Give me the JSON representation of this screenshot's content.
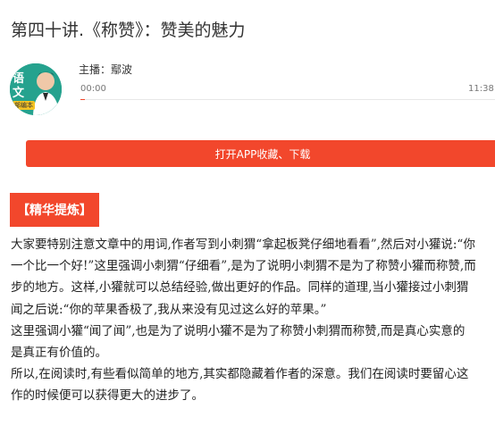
{
  "header": {
    "title": "第四十讲.《称赞》：赞美的魅力"
  },
  "player": {
    "cover_text": "语文",
    "cover_badge": "部编本",
    "host_label": "主播：鄢波",
    "current_time": "00:00",
    "duration": "11:38",
    "progress": 0.01
  },
  "app_button": {
    "label": "打开APP收藏、下载"
  },
  "section": {
    "tag": "【精华提炼】"
  },
  "article": {
    "lines": [
      "大家要特别注意文章中的用词,作者写到小刺猬“拿起板凳仔细地看看”,然后对小獾说:“你",
      "一个比一个好!”这里强调小刺猬“仔细看”,是为了说明小刺猬不是为了称赞小獾而称赞,而",
      "步的地方。这样,小獾就可以总结经验,做出更好的作品。同样的道理,当小獾接过小刺猬",
      "闻之后说:“你的苹果香极了,我从来没有见过这么好的苹果。”",
      "这里强调小獾“闻了闻”,也是为了说明小獾不是为了称赞小刺猬而称赞,而是真心实意的",
      "是真正有价值的。",
      "所以,在阅读时,有些看似简单的地方,其实都隐藏着作者的深意。我们在阅读时要留心这",
      "作的时候便可以获得更大的进步了。"
    ]
  },
  "colors": {
    "accent": "#f2472c",
    "cover": "#1f9a86"
  }
}
